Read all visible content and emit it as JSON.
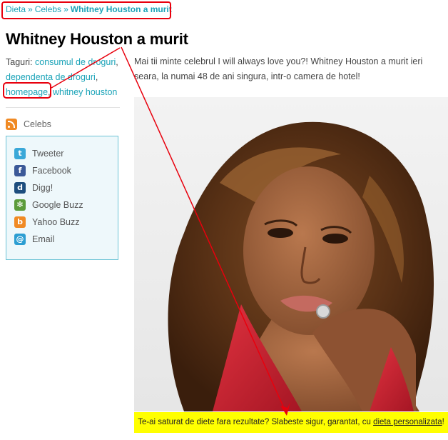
{
  "breadcrumb": {
    "home": "Dieta",
    "sep1": "»",
    "category": "Celebs",
    "sep2": "»",
    "current": "Whitney Houston a murit"
  },
  "article": {
    "title": "Whitney Houston a murit",
    "tags_label": "Taguri:",
    "tags": [
      "consumul de droguri",
      "dependenta de droguri",
      "homepage",
      "whitney houston"
    ],
    "intro": "Mai tii minte celebrul I will always love you?! Whitney Houston a murit ieri seara, la numai 48 de ani singura, intr-o camera de hotel!"
  },
  "sidebar": {
    "category": "Celebs",
    "share": [
      {
        "label": "Tweeter",
        "icon": "twitter-icon",
        "color": "#3aa8d8",
        "glyph": "t"
      },
      {
        "label": "Facebook",
        "icon": "facebook-icon",
        "color": "#3b5998",
        "glyph": "f"
      },
      {
        "label": "Digg!",
        "icon": "digg-icon",
        "color": "#1d4e7e",
        "glyph": "d"
      },
      {
        "label": "Google Buzz",
        "icon": "google-buzz-icon",
        "color": "#5b9b3a",
        "glyph": "✻"
      },
      {
        "label": "Yahoo Buzz",
        "icon": "yahoo-buzz-icon",
        "color": "#f08a24",
        "glyph": "b"
      },
      {
        "label": "Email",
        "icon": "email-icon",
        "color": "#2c9ed2",
        "glyph": "@"
      }
    ]
  },
  "promo": {
    "text": "Te-ai saturat de diete fara rezultate? Slabeste sigur, garantat, cu",
    "link": "dieta personalizata",
    "end": "!"
  },
  "colors": {
    "link": "#1aa3b8",
    "annotation": "#e8000d",
    "promo_bg": "#ffff00"
  }
}
